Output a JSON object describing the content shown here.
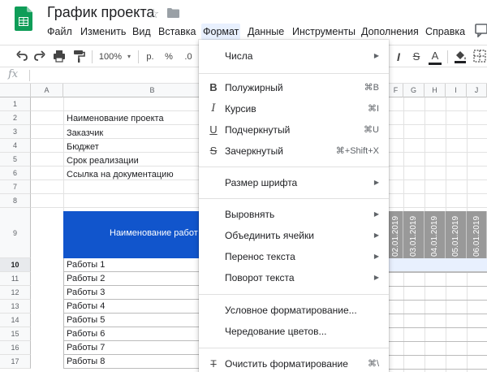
{
  "app": {
    "title": "График проекта"
  },
  "menubar": {
    "items": [
      "Файл",
      "Изменить",
      "Вид",
      "Вставка",
      "Формат",
      "Данные",
      "Инструменты",
      "Дополнения",
      "Справка"
    ],
    "active": "Формат"
  },
  "toolbar": {
    "zoom": "100%",
    "currency": "р.",
    "percent": "%",
    "decimal": ".0"
  },
  "formula_bar": {
    "fx": "fx"
  },
  "grid": {
    "columns": [
      "A",
      "B",
      "F",
      "G",
      "H",
      "I",
      "J"
    ],
    "rows": [
      "1",
      "2",
      "3",
      "4",
      "5",
      "6",
      "7",
      "8",
      "9",
      "10",
      "11",
      "12",
      "13",
      "14",
      "15",
      "16",
      "17"
    ],
    "info_labels": [
      "Наименование проекта",
      "Заказчик",
      "Бюджет",
      "Срок реализации",
      "Ссылка на документацию"
    ],
    "header_label": "Наименование работ",
    "dates": [
      "02.01.2019",
      "03.01.2019",
      "04.01.2019",
      "05.01.2019",
      "06.01.2019"
    ],
    "works": [
      "Работы 1",
      "Работы 2",
      "Работы 3",
      "Работы 4",
      "Работы 5",
      "Работы 6",
      "Работы 7",
      "Работы 8"
    ]
  },
  "format_menu": {
    "numbers": "Числа",
    "bold": "Полужирный",
    "bold_sc": "⌘B",
    "italic": "Курсив",
    "italic_sc": "⌘I",
    "underline": "Подчеркнутый",
    "underline_sc": "⌘U",
    "strike": "Зачеркнутый",
    "strike_sc": "⌘+Shift+X",
    "font_size": "Размер шрифта",
    "align": "Выровнять",
    "merge": "Объединить ячейки",
    "wrap": "Перенос текста",
    "rotate": "Поворот текста",
    "conditional": "Условное форматирование...",
    "alternating": "Чередование цветов...",
    "clear": "Очистить форматирование",
    "clear_sc": "⌘\\"
  },
  "colors": {
    "header_blue": "#1155cc",
    "date_gray": "#999999",
    "sheets_green": "#0f9d58"
  }
}
